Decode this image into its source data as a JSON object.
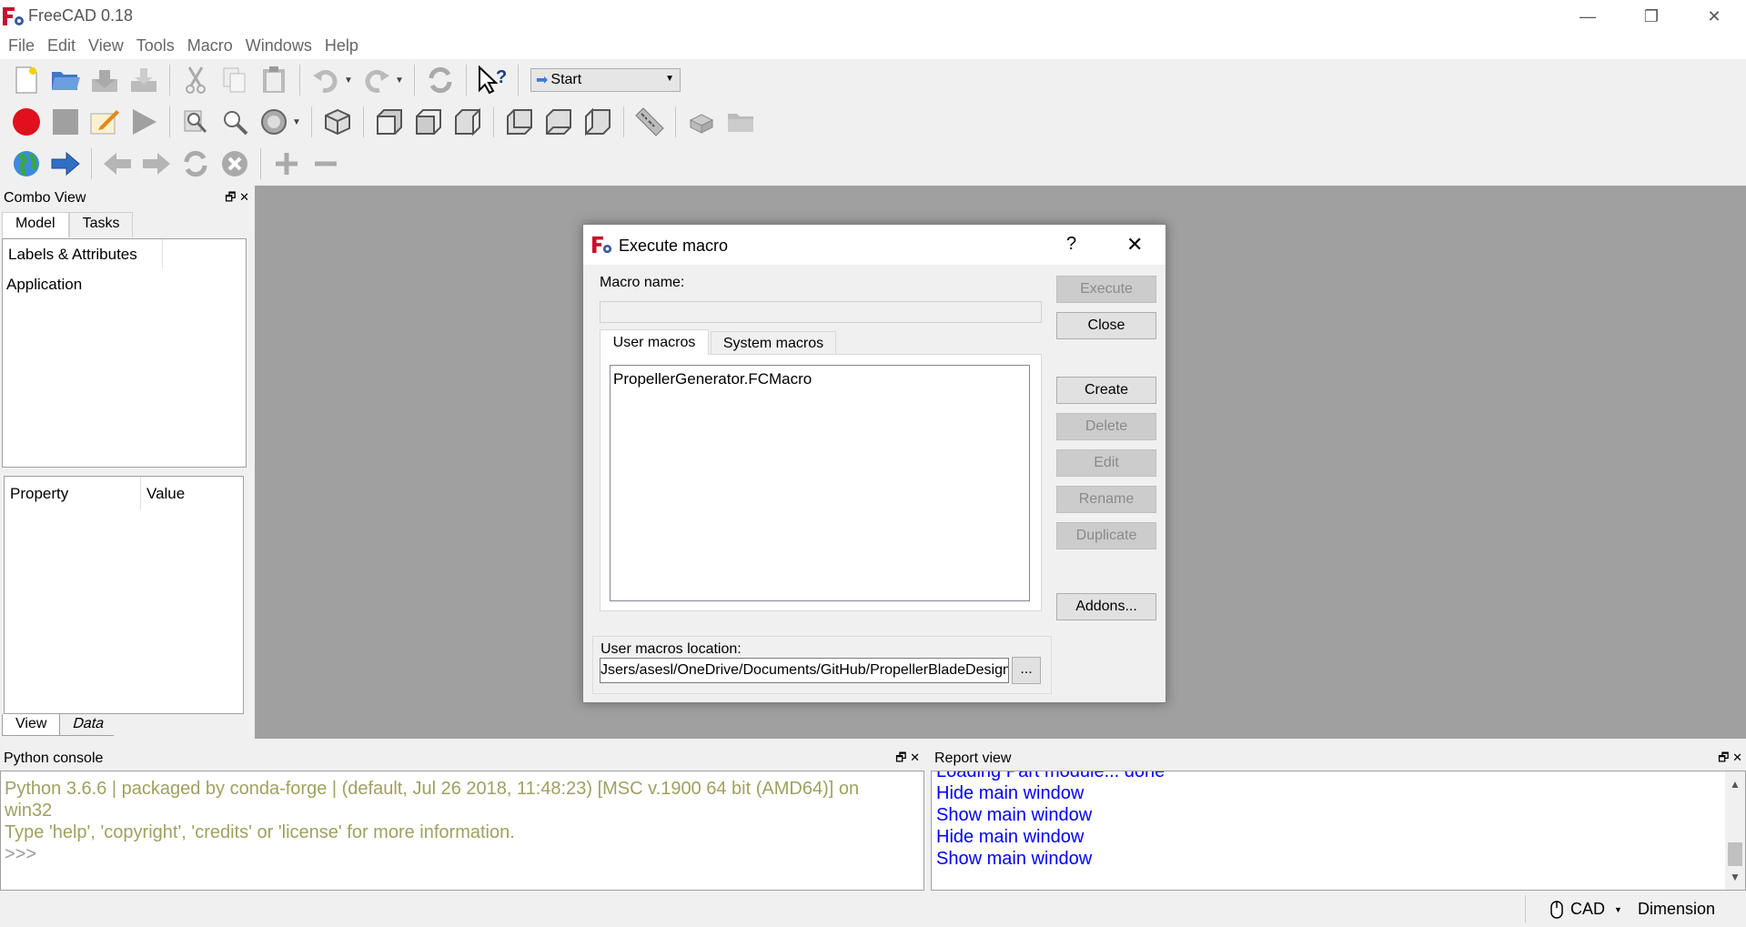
{
  "window": {
    "title": "FreeCAD 0.18",
    "minimize_glyph": "—",
    "restore_glyph": "❐",
    "close_glyph": "✕"
  },
  "menu": [
    "File",
    "Edit",
    "View",
    "Tools",
    "Macro",
    "Windows",
    "Help"
  ],
  "toolbar": {
    "workbench_selected": "Start"
  },
  "combo_view": {
    "title": "Combo View",
    "tabs": [
      "Model",
      "Tasks"
    ],
    "tree_header": "Labels & Attributes",
    "tree_root": "Application",
    "property_header": "Property",
    "value_header": "Value",
    "bottom_tabs": [
      "View",
      "Data"
    ]
  },
  "dialog": {
    "title": "Execute macro",
    "help_glyph": "?",
    "close_glyph": "✕",
    "macro_name_label": "Macro name:",
    "macro_name_value": "",
    "tabs": [
      "User macros",
      "System macros"
    ],
    "macros": [
      "PropellerGenerator.FCMacro"
    ],
    "buttons": {
      "execute": "Execute",
      "close": "Close",
      "create": "Create",
      "delete": "Delete",
      "edit": "Edit",
      "rename": "Rename",
      "duplicate": "Duplicate",
      "addons": "Addons..."
    },
    "location_label": "User macros location:",
    "location_value": "Jsers/asesl/OneDrive/Documents/GitHub/PropellerBladeDesign",
    "browse_label": "..."
  },
  "python_console": {
    "title": "Python console",
    "lines": [
      "Python 3.6.6 | packaged by conda-forge | (default, Jul 26 2018, 11:48:23) [MSC v.1900 64 bit (AMD64)] on",
      "win32",
      "Type 'help', 'copyright', 'credits' or 'license' for more information.",
      ">>>"
    ]
  },
  "report_view": {
    "title": "Report view",
    "partial_line": "Loading Part module... done",
    "lines": [
      "Hide main window",
      "Show main window",
      "Hide main window",
      "Show main window"
    ]
  },
  "statusbar": {
    "nav_style": "CAD",
    "dimension": "Dimension"
  },
  "colors": {
    "console_text": "#a0a060",
    "report_text": "#0000ff",
    "view_bg": "#a0a0a0"
  }
}
